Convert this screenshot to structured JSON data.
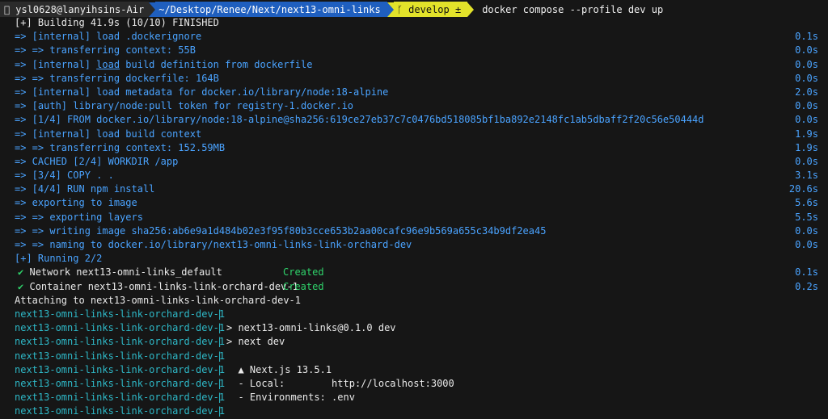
{
  "prompt": {
    "apple_icon": "apple-icon",
    "user": "ysl0628@lanyihsins-Air",
    "path": "~/Desktop/Renee/Next/next13-omni-links",
    "branch": "develop ±",
    "command": "docker compose --profile dev up"
  },
  "build": {
    "header": "[+] Building 41.9s (10/10) FINISHED",
    "steps": [
      {
        "text": "=> [internal] load .dockerignore",
        "dur": "0.1s"
      },
      {
        "text": "=> => transferring context: 55B",
        "dur": "0.0s"
      },
      {
        "pre": "=> [internal] ",
        "u": "load",
        "post": " build definition from dockerfile",
        "dur": "0.0s"
      },
      {
        "text": "=> => transferring dockerfile: 164B",
        "dur": "0.0s"
      },
      {
        "text": "=> [internal] load metadata for docker.io/library/node:18-alpine",
        "dur": "2.0s"
      },
      {
        "text": "=> [auth] library/node:pull token for registry-1.docker.io",
        "dur": "0.0s"
      },
      {
        "text": "=> [1/4] FROM docker.io/library/node:18-alpine@sha256:619ce27eb37c7c0476bd518085bf1ba892e2148fc1ab5dbaff2f20c56e50444d",
        "dur": "0.0s"
      },
      {
        "text": "=> [internal] load build context",
        "dur": "1.9s"
      },
      {
        "text": "=> => transferring context: 152.59MB",
        "dur": "1.9s"
      },
      {
        "text": "=> CACHED [2/4] WORKDIR /app",
        "dur": "0.0s"
      },
      {
        "text": "=> [3/4] COPY . .",
        "dur": "3.1s"
      },
      {
        "text": "=> [4/4] RUN npm install",
        "dur": "20.6s"
      },
      {
        "text": "=> exporting to image",
        "dur": "5.6s"
      },
      {
        "text": "=> => exporting layers",
        "dur": "5.5s"
      },
      {
        "text": "=> => writing image sha256:ab6e9a1d484b02e3f95f80b3cce653b2aa00cafc96e9b569a655c34b9df2ea45",
        "dur": "0.0s"
      },
      {
        "text": "=> => naming to docker.io/library/next13-omni-links-link-orchard-dev",
        "dur": "0.0s"
      }
    ]
  },
  "running": {
    "header": "[+] Running 2/2",
    "items": [
      {
        "check": "✔",
        "label": "Network next13-omni-links_default",
        "status": "Created",
        "dur": "0.1s"
      },
      {
        "check": "✔",
        "label": "Container next13-omni-links-link-orchard-dev-1",
        "status": "Created",
        "dur": "0.2s"
      }
    ]
  },
  "attach": "Attaching to next13-omni-links-link-orchard-dev-1",
  "logs": [
    {
      "name": "next13-omni-links-link-orchard-dev-1",
      "pipe": "|",
      "text": ""
    },
    {
      "name": "next13-omni-links-link-orchard-dev-1",
      "pipe": "|",
      "text": "> next13-omni-links@0.1.0 dev"
    },
    {
      "name": "next13-omni-links-link-orchard-dev-1",
      "pipe": "|",
      "text": "> next dev"
    },
    {
      "name": "next13-omni-links-link-orchard-dev-1",
      "pipe": "|",
      "text": ""
    },
    {
      "name": "next13-omni-links-link-orchard-dev-1",
      "pipe": "|",
      "text": "  ▲ Next.js 13.5.1"
    },
    {
      "name": "next13-omni-links-link-orchard-dev-1",
      "pipe": "|",
      "text": "  - Local:        http://localhost:3000"
    },
    {
      "name": "next13-omni-links-link-orchard-dev-1",
      "pipe": "|",
      "text": "  - Environments: .env"
    },
    {
      "name": "next13-omni-links-link-orchard-dev-1",
      "pipe": "|",
      "text": ""
    }
  ]
}
